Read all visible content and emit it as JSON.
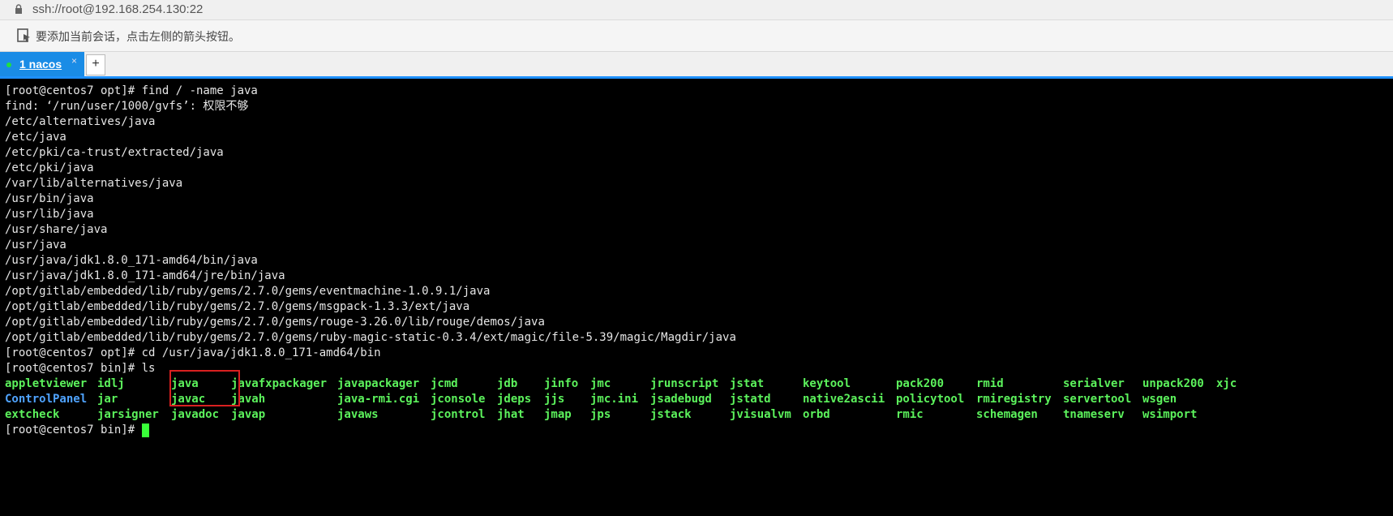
{
  "address_bar": {
    "url": "ssh://root@192.168.254.130:22"
  },
  "hint_bar": {
    "text": "要添加当前会话，点击左侧的箭头按钮。",
    "icon": "arrow-bookmark-icon"
  },
  "tabs": [
    {
      "label": "1 nacos",
      "close": "×"
    }
  ],
  "new_tab_label": "+",
  "colors": {
    "tab_active": "#1a8ce6",
    "exec_green": "#5cf25c",
    "dir_blue": "#4fa3ff",
    "highlight_red": "#d92020"
  },
  "terminal": {
    "lines": [
      "[root@centos7 opt]# find / -name java",
      "find: ‘/run/user/1000/gvfs’: 权限不够",
      "/etc/alternatives/java",
      "/etc/java",
      "/etc/pki/ca-trust/extracted/java",
      "/etc/pki/java",
      "/var/lib/alternatives/java",
      "/usr/bin/java",
      "/usr/lib/java",
      "/usr/share/java",
      "/usr/java",
      "/usr/java/jdk1.8.0_171-amd64/bin/java",
      "/usr/java/jdk1.8.0_171-amd64/jre/bin/java",
      "/opt/gitlab/embedded/lib/ruby/gems/2.7.0/gems/eventmachine-1.0.9.1/java",
      "/opt/gitlab/embedded/lib/ruby/gems/2.7.0/gems/msgpack-1.3.3/ext/java",
      "/opt/gitlab/embedded/lib/ruby/gems/2.7.0/gems/rouge-3.26.0/lib/rouge/demos/java",
      "/opt/gitlab/embedded/lib/ruby/gems/2.7.0/gems/ruby-magic-static-0.3.4/ext/magic/file-5.39/magic/Magdir/java",
      "[root@centos7 opt]# cd /usr/java/jdk1.8.0_171-amd64/bin",
      "[root@centos7 bin]# ls"
    ],
    "ls_rows": [
      [
        "appletviewer",
        "idlj",
        "java",
        "javafxpackager",
        "javapackager",
        "jcmd",
        "jdb",
        "jinfo",
        "jmc",
        "jrunscript",
        "jstat",
        "keytool",
        "pack200",
        "rmid",
        "serialver",
        "unpack200",
        "xjc"
      ],
      [
        "ControlPanel",
        "jar",
        "javac",
        "javah",
        "java-rmi.cgi",
        "jconsole",
        "jdeps",
        "jjs",
        "jmc.ini",
        "jsadebugd",
        "jstatd",
        "native2ascii",
        "policytool",
        "rmiregistry",
        "servertool",
        "wsgen",
        ""
      ],
      [
        "extcheck",
        "jarsigner",
        "javadoc",
        "javap",
        "javaws",
        "jcontrol",
        "jhat",
        "jmap",
        "jps",
        "jstack",
        "jvisualvm",
        "orbd",
        "rmic",
        "schemagen",
        "tnameserv",
        "wsimport",
        ""
      ]
    ],
    "prompt": "[root@centos7 bin]# "
  }
}
